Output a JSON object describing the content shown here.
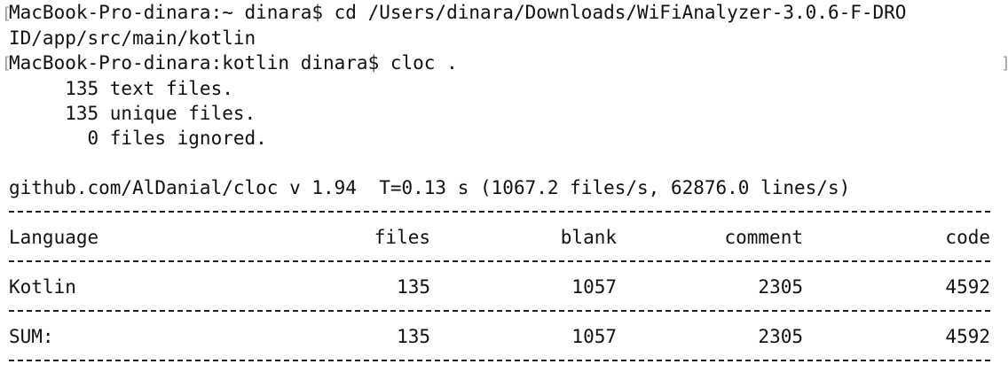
{
  "prompt_lines": [
    "MacBook-Pro-dinara:~ dinara$ cd /Users/dinara/Downloads/WiFiAnalyzer-3.0.6-F-DRO",
    "ID/app/src/main/kotlin",
    "MacBook-Pro-dinara:kotlin dinara$ cloc ."
  ],
  "summary_lines": [
    "     135 text files.",
    "     135 unique files.",
    "       0 files ignored."
  ],
  "header_line": "github.com/AlDanial/cloc v 1.94  T=0.13 s (1067.2 files/s, 62876.0 lines/s)",
  "table": {
    "columns": [
      "Language",
      "files",
      "blank",
      "comment",
      "code"
    ],
    "rows": [
      {
        "language": "Kotlin",
        "files": "135",
        "blank": "1057",
        "comment": "2305",
        "code": "4592"
      }
    ],
    "sum": {
      "language": "SUM:",
      "files": "135",
      "blank": "1057",
      "comment": "2305",
      "code": "4592"
    }
  }
}
